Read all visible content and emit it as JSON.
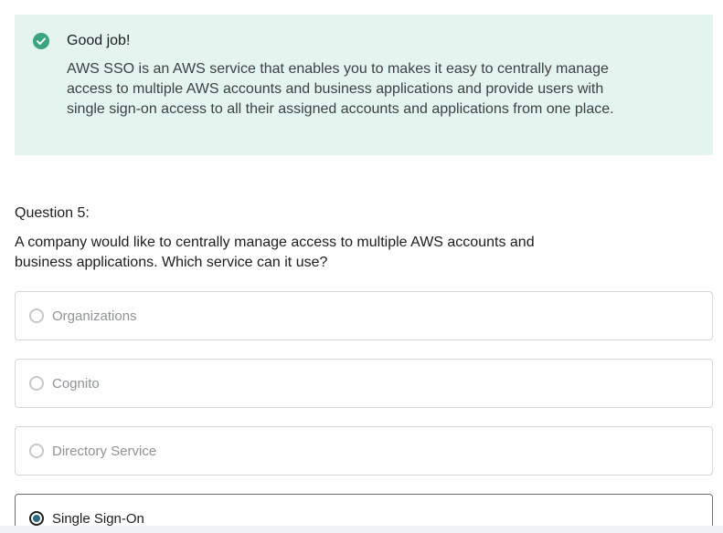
{
  "feedback": {
    "icon": "check-circle-icon",
    "title": "Good job!",
    "body": "AWS SSO is an AWS service that enables you to makes it easy to centrally manage access to multiple AWS accounts and business applications and provide users with single sign-on access to all their assigned accounts and applications from one place.",
    "background_color": "#e4f4ee",
    "accent_color": "#3aa57f"
  },
  "question": {
    "label": "Question 5:",
    "text": "A company would like to centrally manage access to multiple AWS accounts and business applications. Which service can it use?"
  },
  "options": [
    {
      "label": "Organizations",
      "selected": false
    },
    {
      "label": "Cognito",
      "selected": false
    },
    {
      "label": "Directory Service",
      "selected": false
    },
    {
      "label": "Single Sign-On",
      "selected": true
    }
  ]
}
